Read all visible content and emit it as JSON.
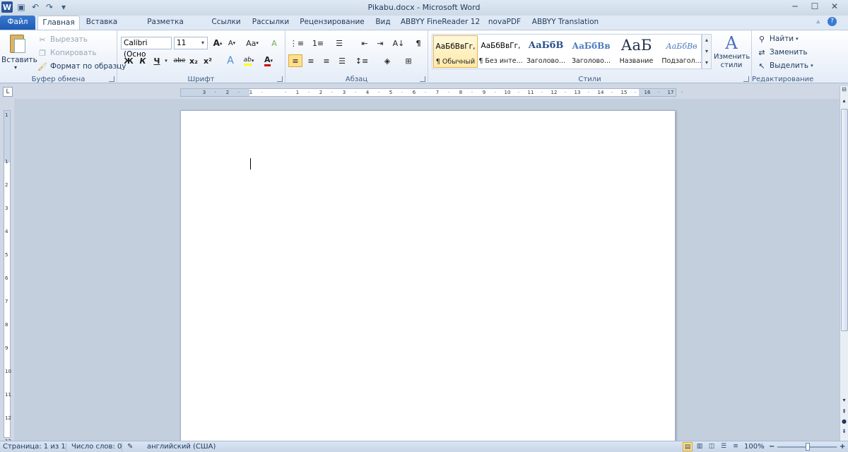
{
  "window": {
    "title": "Pikabu.docx - Microsoft Word"
  },
  "tabs": [
    "Файл",
    "Главная",
    "Вставка",
    "Разметка страницы",
    "Ссылки",
    "Рассылки",
    "Рецензирование",
    "Вид",
    "ABBYY FineReader 12",
    "novaPDF",
    "ABBYY Translation"
  ],
  "clipboard": {
    "paste": "Вставить",
    "cut": "Вырезать",
    "copy": "Копировать",
    "format_painter": "Формат по образцу",
    "label": "Буфер обмена"
  },
  "font": {
    "name": "Calibri (Осно",
    "size": "11",
    "label": "Шрифт",
    "bold": "Ж",
    "italic": "К",
    "underline": "Ч",
    "strike": "abe",
    "sub": "x₂",
    "sup": "x²",
    "grow": "A",
    "shrink": "A",
    "case": "Aa",
    "clear": "A"
  },
  "paragraph": {
    "label": "Абзац"
  },
  "styles": {
    "label": "Стили",
    "items": [
      {
        "preview": "АаБбВвГг,",
        "name": "¶ Обычный"
      },
      {
        "preview": "АаБбВвГг,",
        "name": "¶ Без инте..."
      },
      {
        "preview": "АаБбВ",
        "name": "Заголово..."
      },
      {
        "preview": "АаБбВв",
        "name": "Заголово..."
      },
      {
        "preview": "АаБ",
        "name": "Название"
      },
      {
        "preview": "АаБбВв",
        "name": "Подзагол..."
      }
    ],
    "change": "Изменить стили"
  },
  "editing": {
    "find": "Найти",
    "replace": "Заменить",
    "select": "Выделить",
    "label": "Редактирование"
  },
  "ruler": {
    "marks": [
      "3",
      "2",
      "1",
      "",
      "1",
      "2",
      "3",
      "4",
      "5",
      "6",
      "7",
      "8",
      "9",
      "10",
      "11",
      "12",
      "13",
      "14",
      "15",
      "16",
      "17"
    ]
  },
  "vruler": {
    "marks": [
      "1",
      "",
      "1",
      "2",
      "3",
      "4",
      "5",
      "6",
      "7",
      "8",
      "9",
      "10",
      "11",
      "12",
      "13"
    ]
  },
  "status": {
    "page": "Страница: 1 из 1",
    "words": "Число слов: 0",
    "language": "английский (США)",
    "zoom": "100%"
  },
  "colors": {
    "file_tab": "#2b62bb",
    "highlight": "#ffff00",
    "font_color": "#d00000"
  }
}
